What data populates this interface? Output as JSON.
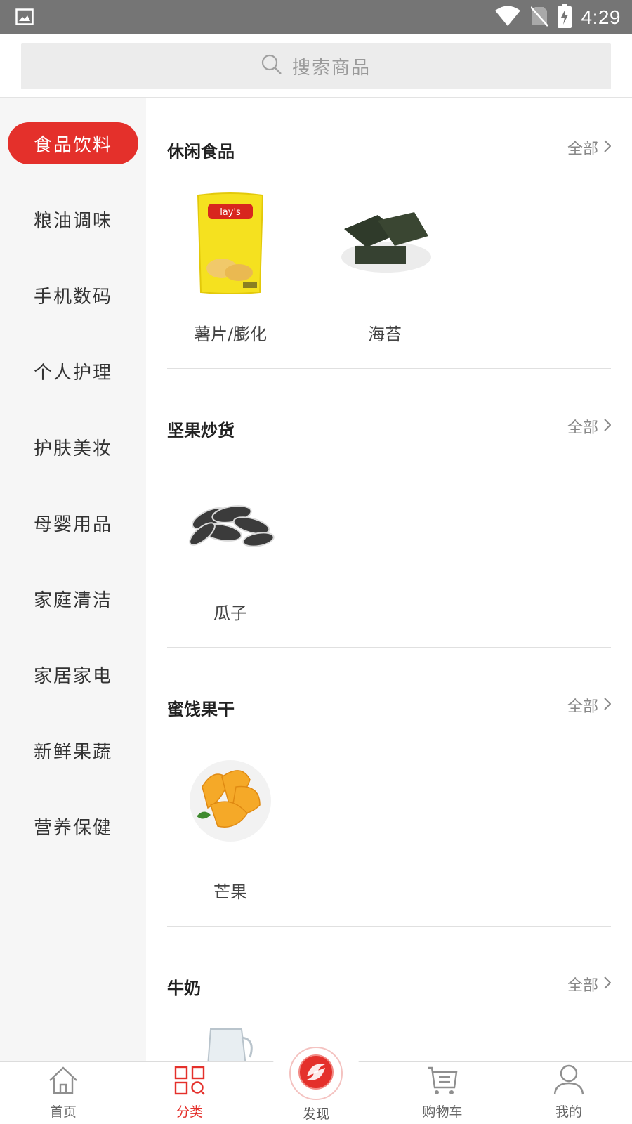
{
  "status_bar": {
    "time": "4:29",
    "icons": [
      "image-icon",
      "wifi-icon",
      "no-sim-icon",
      "battery-charging-icon"
    ]
  },
  "search": {
    "placeholder": "搜索商品"
  },
  "sidebar": {
    "items": [
      {
        "label": "食品饮料",
        "active": true
      },
      {
        "label": "粮油调味",
        "active": false
      },
      {
        "label": "手机数码",
        "active": false
      },
      {
        "label": "个人护理",
        "active": false
      },
      {
        "label": "护肤美妆",
        "active": false
      },
      {
        "label": "母婴用品",
        "active": false
      },
      {
        "label": "家庭清洁",
        "active": false
      },
      {
        "label": "家居家电",
        "active": false
      },
      {
        "label": "新鲜果蔬",
        "active": false
      },
      {
        "label": "营养保健",
        "active": false
      }
    ]
  },
  "sections": [
    {
      "title": "休闲食品",
      "all_label": "全部",
      "products": [
        {
          "name": "薯片/膨化",
          "icon": "potato-chips-bag"
        },
        {
          "name": "海苔",
          "icon": "seaweed-snack"
        }
      ]
    },
    {
      "title": "坚果炒货",
      "all_label": "全部",
      "products": [
        {
          "name": "瓜子",
          "icon": "sunflower-seeds"
        }
      ]
    },
    {
      "title": "蜜饯果干",
      "all_label": "全部",
      "products": [
        {
          "name": "芒果",
          "icon": "dried-mango"
        }
      ]
    },
    {
      "title": "牛奶",
      "all_label": "全部",
      "products": []
    }
  ],
  "bottom_nav": {
    "items": [
      {
        "label": "首页",
        "icon": "home-icon",
        "active": false
      },
      {
        "label": "分类",
        "icon": "category-icon",
        "active": true
      },
      {
        "label": "发现",
        "icon": "discover-icon",
        "active": false
      },
      {
        "label": "购物车",
        "icon": "cart-icon",
        "active": false
      },
      {
        "label": "我的",
        "icon": "user-icon",
        "active": false
      }
    ]
  },
  "colors": {
    "accent": "#e4302b",
    "statusbar": "#757575",
    "sidebar_bg": "#f6f6f6",
    "search_bg": "#ececec"
  }
}
